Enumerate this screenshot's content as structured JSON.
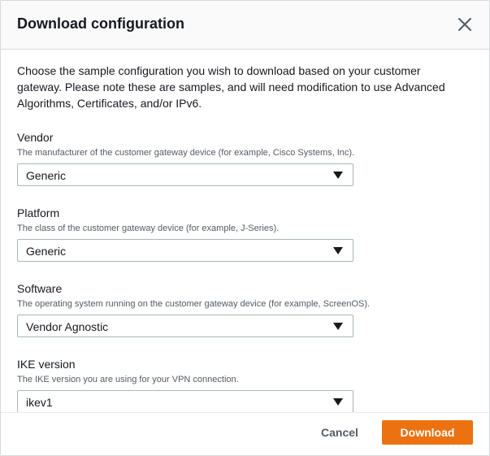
{
  "dialog": {
    "title": "Download configuration",
    "intro": "Choose the sample configuration you wish to download based on your customer gateway. Please note these are samples, and will need modification to use Advanced Algorithms, Certificates, and/or IPv6."
  },
  "fields": [
    {
      "label": "Vendor",
      "description": "The manufacturer of the customer gateway device (for example, Cisco Systems, Inc).",
      "value": "Generic"
    },
    {
      "label": "Platform",
      "description": "The class of the customer gateway device (for example, J-Series).",
      "value": "Generic"
    },
    {
      "label": "Software",
      "description": "The operating system running on the customer gateway device (for example, ScreenOS).",
      "value": "Vendor Agnostic"
    },
    {
      "label": "IKE version",
      "description": "The IKE version you are using for your VPN connection.",
      "value": "ikev1"
    }
  ],
  "footer": {
    "cancel_label": "Cancel",
    "download_label": "Download"
  },
  "icons": {
    "close": "close-icon",
    "caret": "caret-down-icon"
  },
  "colors": {
    "primary_button": "#ec7211",
    "text": "#16191f",
    "secondary_text": "#545b64",
    "border": "#aab7b8"
  }
}
